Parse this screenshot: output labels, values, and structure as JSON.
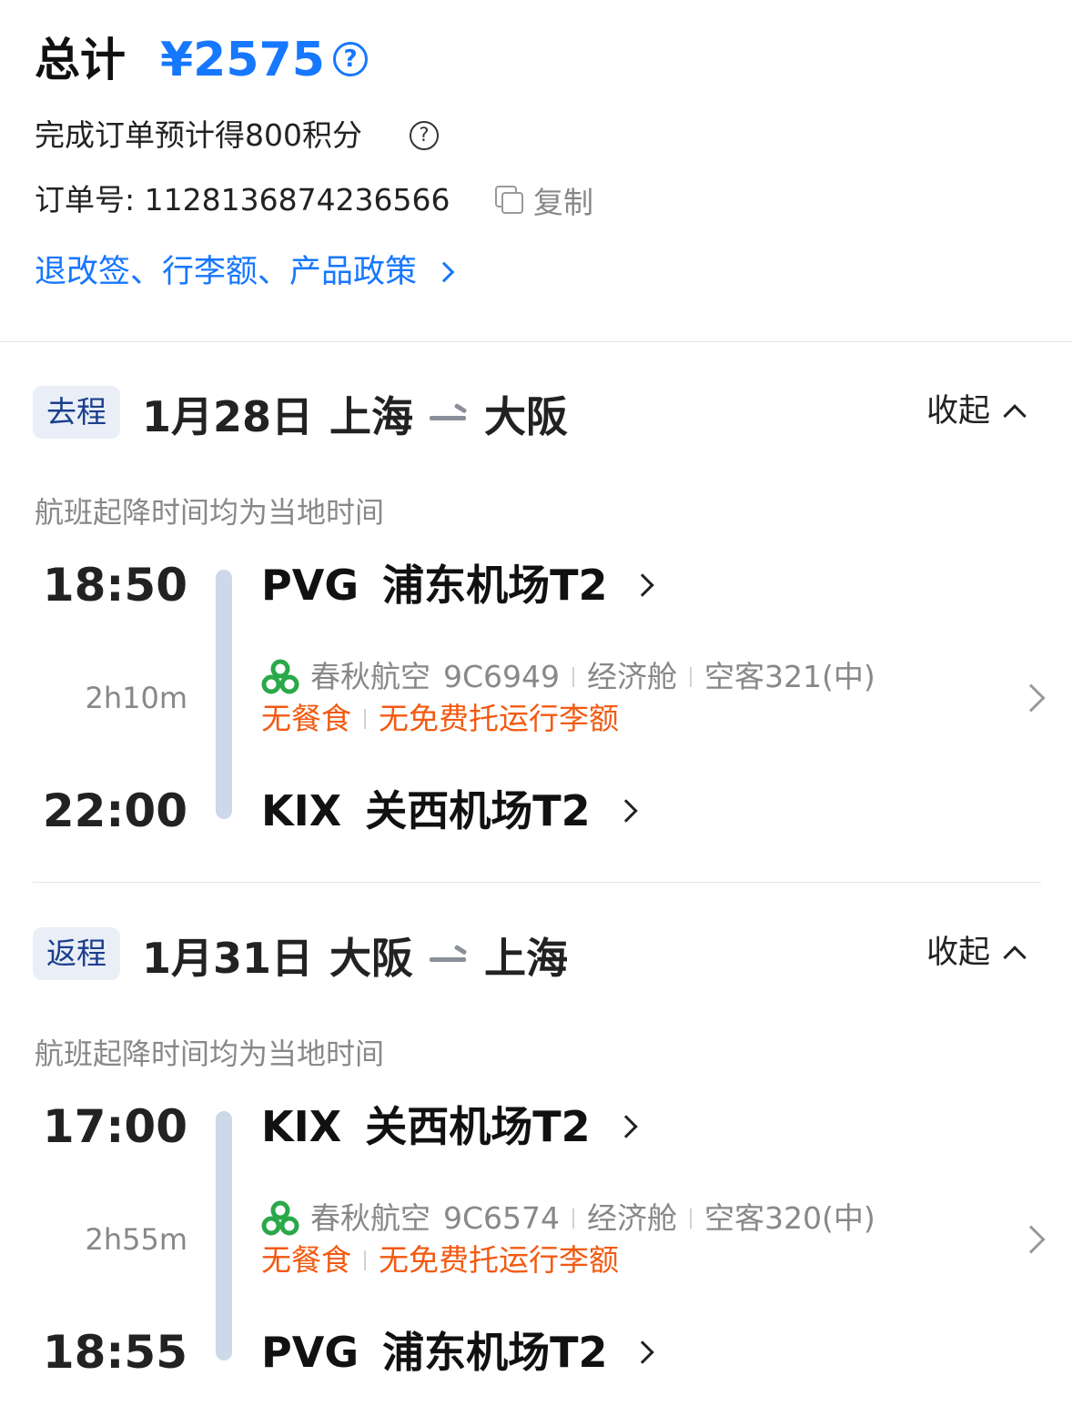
{
  "summary": {
    "total_label": "总计",
    "total_amount": "¥2575",
    "points_text": "完成订单预计得800积分",
    "order_label": "订单号: 1128136874236566",
    "copy_label": "复制",
    "policy_link": "退改签、行李额、产品政策"
  },
  "trips": [
    {
      "tag": "去程",
      "date": "1月28日",
      "from": "上海",
      "to": "大阪",
      "collapse_label": "收起",
      "note": "航班起降时间均为当地时间",
      "depart_time": "18:50",
      "duration": "2h10m",
      "arrive_time": "22:00",
      "depart_code": "PVG",
      "depart_airport": "浦东机场T2",
      "arrive_code": "KIX",
      "arrive_airport": "关西机场T2",
      "airline": "春秋航空",
      "flight_no": "9C6949",
      "cabin": "经济舱",
      "aircraft": "空客321(中)",
      "meal": "无餐食",
      "baggage": "无免费托运行李额"
    },
    {
      "tag": "返程",
      "date": "1月31日",
      "from": "大阪",
      "to": "上海",
      "collapse_label": "收起",
      "note": "航班起降时间均为当地时间",
      "depart_time": "17:00",
      "duration": "2h55m",
      "arrive_time": "18:55",
      "depart_code": "KIX",
      "depart_airport": "关西机场T2",
      "arrive_code": "PVG",
      "arrive_airport": "浦东机场T2",
      "airline": "春秋航空",
      "flight_no": "9C6574",
      "cabin": "经济舱",
      "aircraft": "空客320(中)",
      "meal": "无餐食",
      "baggage": "无免费托运行李额"
    }
  ],
  "icons": {
    "help": "question-circle-icon",
    "copy": "copy-icon",
    "airline_logo": "spring-airlines-logo-icon"
  },
  "colors": {
    "accent": "#1677ff",
    "warning": "#f25a12",
    "timeline": "#cdd8e8"
  }
}
